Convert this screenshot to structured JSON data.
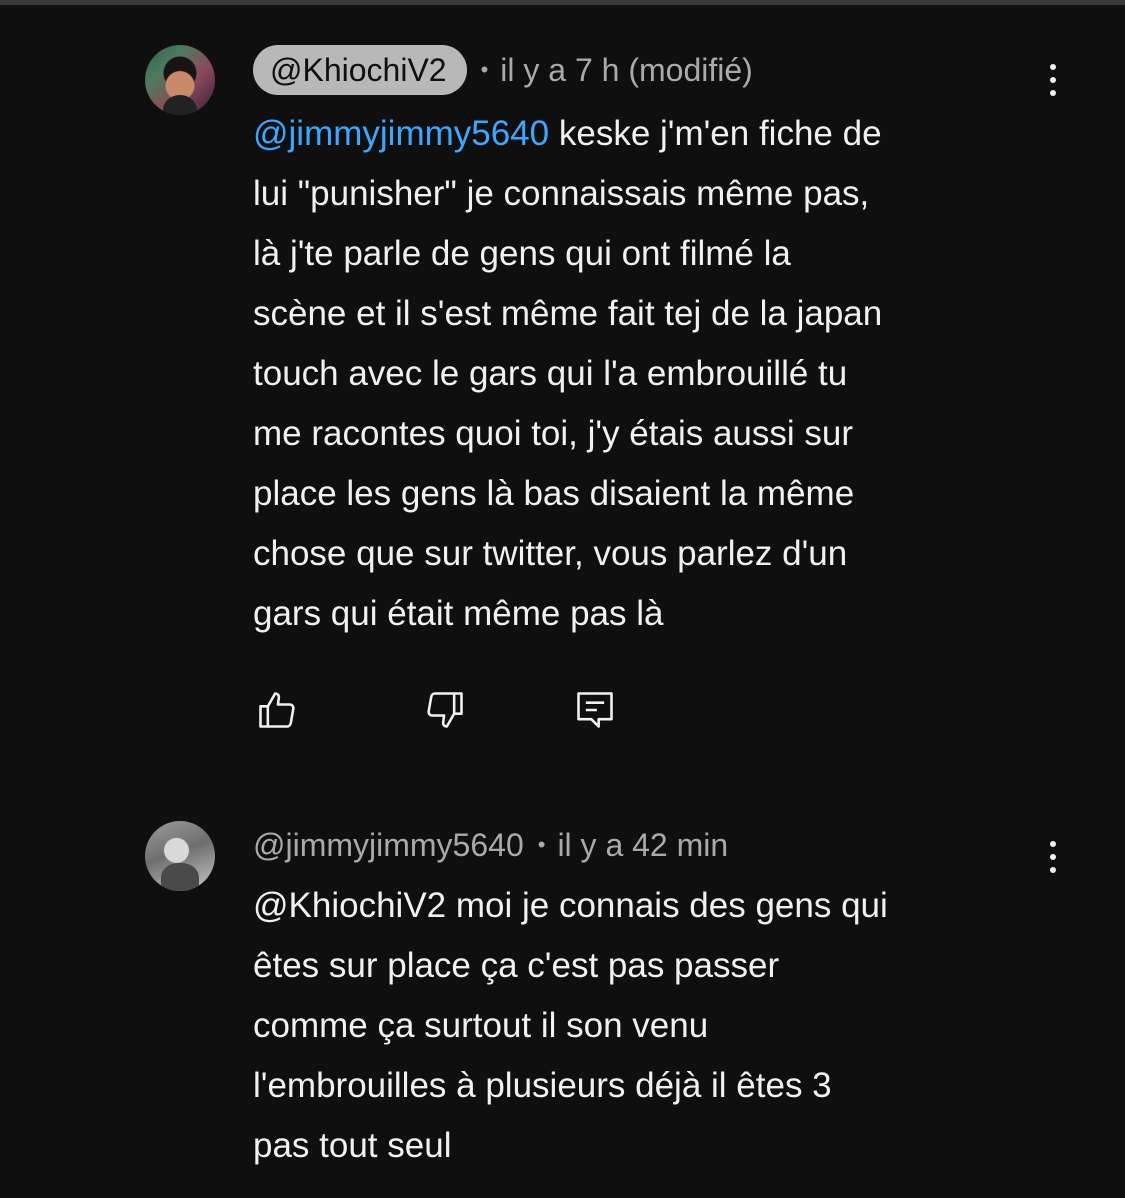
{
  "comments": [
    {
      "author": "@KhiochiV2",
      "separator": "•",
      "time": "il y a 7 h (modifié)",
      "mention": "@jimmyjimmy5640",
      "lines": [
        " keske j'm'en fiche de",
        "lui \"punisher\" je connaissais même pas,",
        "là j'te parle de gens qui ont filmé la",
        "scène et il s'est même fait tej de la japan",
        "touch avec le gars qui l'a embrouillé tu",
        "me racontes quoi toi, j'y étais aussi sur",
        "place les gens là bas disaient la même",
        "chose que sur twitter, vous parlez d'un",
        "gars qui était même pas là"
      ]
    },
    {
      "author": "@jimmyjimmy5640",
      "separator": "•",
      "time": "il y a 42 min",
      "lines": [
        "@KhiochiV2 moi je connais des gens qui",
        "êtes sur place ça c'est pas passer",
        "comme ça surtout il son venu",
        "l'embrouilles à plusieurs déjà il êtes 3",
        "pas tout seul"
      ]
    }
  ],
  "actions": {
    "like_icon": "thumbs-up-icon",
    "dislike_icon": "thumbs-down-icon",
    "reply_icon": "reply-comment-icon"
  },
  "colors": {
    "background": "#0f0f0f",
    "text": "#f1f1f1",
    "secondary_text": "#aaaaaa",
    "mention_link": "#3ea6ff",
    "highlight_pill": "#b8b8b8"
  }
}
